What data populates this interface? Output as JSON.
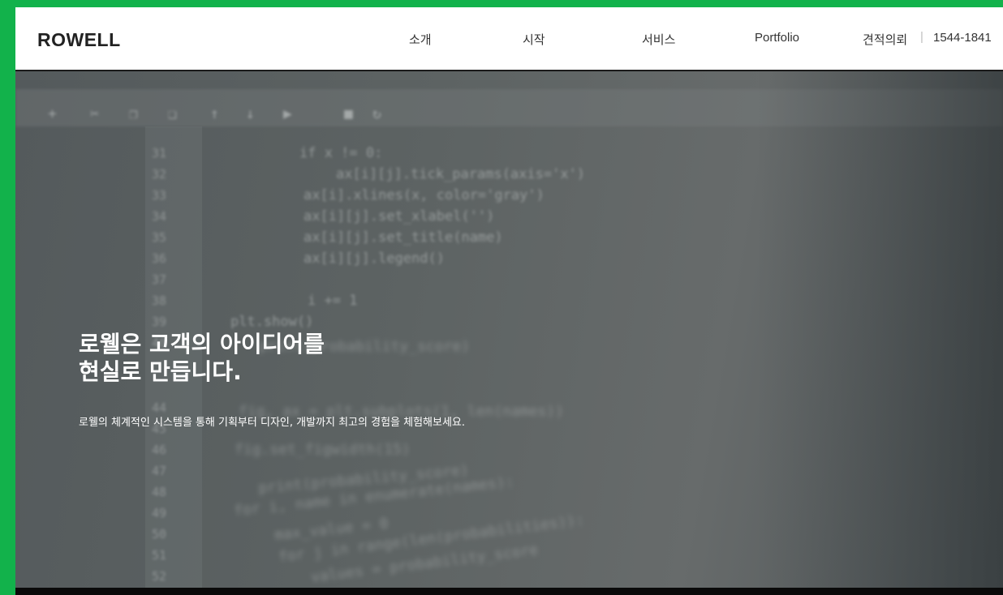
{
  "header": {
    "logo": "ROWELL",
    "nav": [
      {
        "label": "소개"
      },
      {
        "label": "시작"
      },
      {
        "label": "서비스"
      },
      {
        "label": "Portfolio"
      },
      {
        "label": "견적의뢰"
      }
    ],
    "phone": "1544-1841"
  },
  "hero": {
    "title_line1": "로웰은 고객의 아이디어를",
    "title_line2": "현실로 만듭니다.",
    "subtitle": "로웰의 체계적인 시스템을 통해 기획부터 디자인, 개발까지 최고의 경험을 체험해보세요."
  },
  "colors": {
    "frame_border": "#12b24b",
    "header_bg": "#ffffff",
    "hero_text": "#ffffff"
  }
}
